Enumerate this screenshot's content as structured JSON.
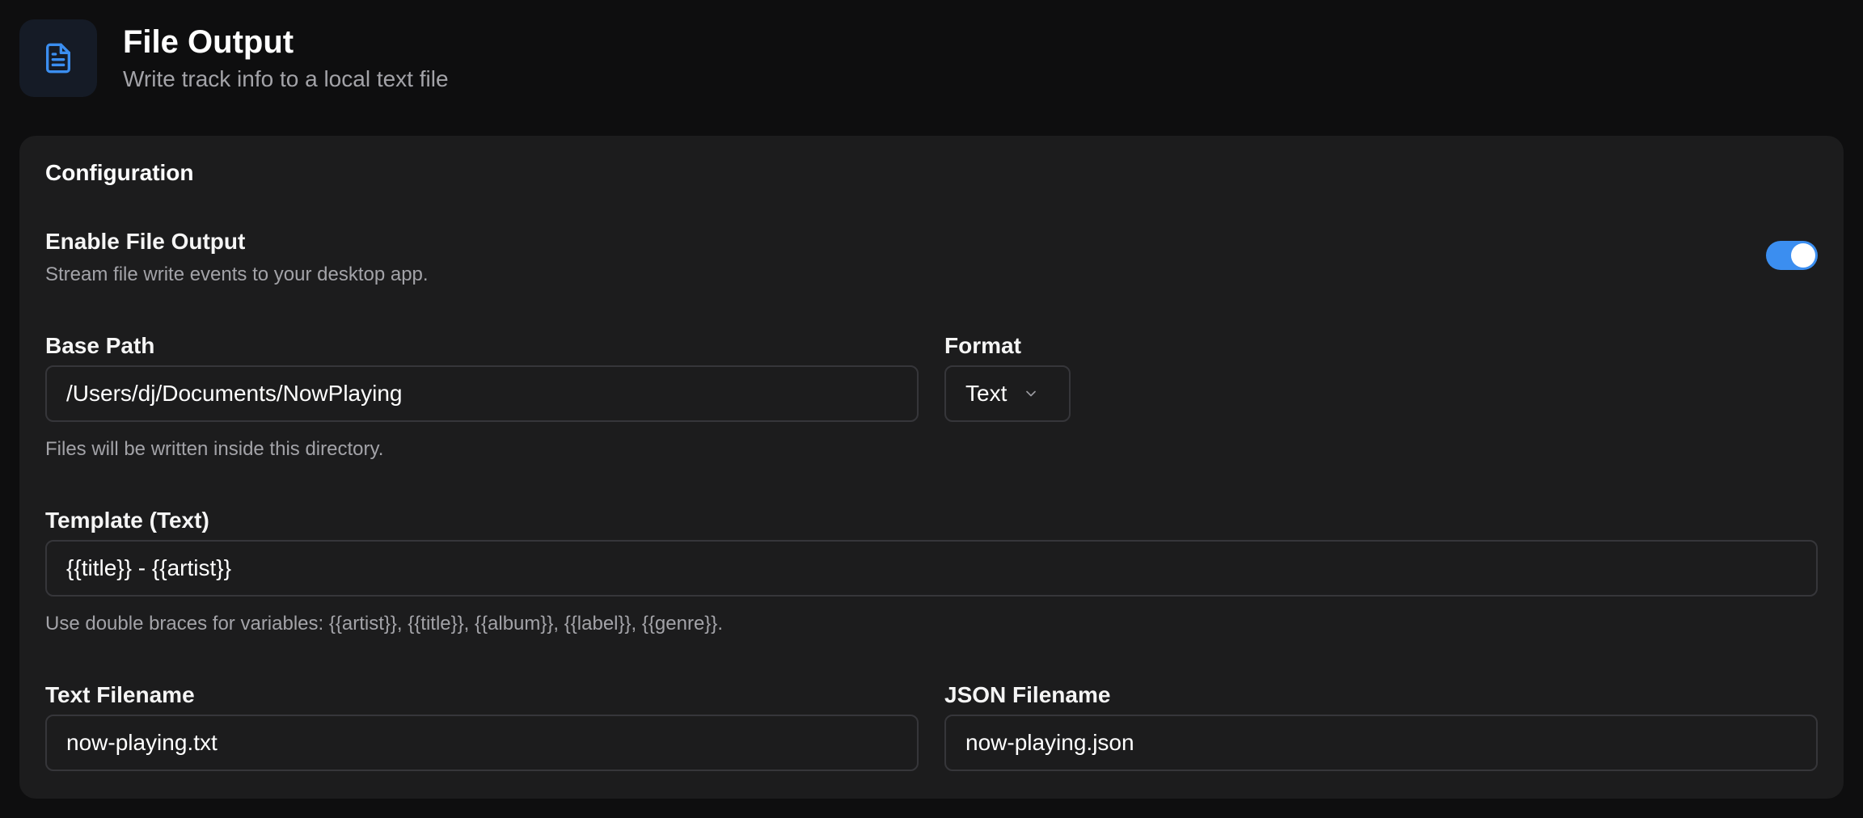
{
  "header": {
    "icon": "file-text-icon",
    "title": "File Output",
    "subtitle": "Write track info to a local text file"
  },
  "config": {
    "title": "Configuration",
    "enable": {
      "label": "Enable File Output",
      "description": "Stream file write events to your desktop app.",
      "enabled": true
    },
    "base_path": {
      "label": "Base Path",
      "value": "/Users/dj/Documents/NowPlaying",
      "hint": "Files will be written inside this directory."
    },
    "format": {
      "label": "Format",
      "value": "Text",
      "icon": "chevron-down-icon"
    },
    "template": {
      "label": "Template (Text)",
      "value": "{{title}} - {{artist}}",
      "hint": "Use double braces for variables: {{artist}}, {{title}}, {{album}}, {{label}}, {{genre}}."
    },
    "text_filename": {
      "label": "Text Filename",
      "value": "now-playing.txt"
    },
    "json_filename": {
      "label": "JSON Filename",
      "value": "now-playing.json"
    }
  },
  "colors": {
    "background": "#0e0e0f",
    "card": "#1c1c1d",
    "accent": "#3b8ef0",
    "icon_bg": "#151b26"
  }
}
